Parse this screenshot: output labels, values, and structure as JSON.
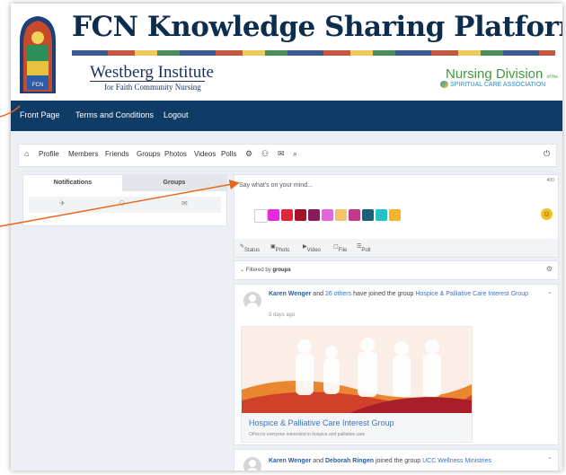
{
  "header": {
    "title": "FCN Knowledge Sharing Platform",
    "westberg": "Westberg Institute",
    "westberg_sub": "for Faith Community Nursing",
    "nursing_division": "Nursing Division",
    "nursing_division_sup": "of the",
    "nursing_division_sub": "SPIRITUAL CARE ASSOCIATION"
  },
  "nav": {
    "items": [
      "Front Page",
      "Terms and Conditions",
      "Logout"
    ]
  },
  "toolbar": {
    "items": [
      "Profile",
      "Members",
      "Friends",
      "Groups",
      "Photos",
      "Videos",
      "Polls"
    ]
  },
  "left_panel": {
    "tab_active": "Notifications",
    "tab_inactive": "Groups"
  },
  "composer": {
    "placeholder": "Say what's on your mind...",
    "counter": "400",
    "colors": [
      "#ffffff",
      "#e52bd9",
      "#e0263b",
      "#a31327",
      "#8b1a5a",
      "#e06ad5",
      "#f3c46a",
      "#c2388b",
      "#1a6178",
      "#26c0c6",
      "#f3b52c"
    ],
    "tabs": [
      "Status",
      "Photo",
      "Video",
      "File",
      "Poll"
    ]
  },
  "filter": {
    "prefix": "Filtered by",
    "value": "groups"
  },
  "feed": [
    {
      "name": "Karen Wenger",
      "connector": "and",
      "others": "26 others",
      "action": "have joined the group",
      "group": "Hospice & Palliative Care Interest Group",
      "time": "3 days ago",
      "card_title": "Hospice & Palliative Care Interest Group",
      "card_desc": "OPen to everyone interested in hospice and palliative care"
    },
    {
      "name": "Karen Wenger",
      "connector": "and",
      "others": "Deborah Ringen",
      "action": "joined the group",
      "group": "UCC Wellness Ministries"
    }
  ],
  "colors": {
    "nav_bg": "#0e3c66",
    "title": "#0d2d4f",
    "link": "#3a74c5",
    "annotation_arrow": "#e8661a"
  }
}
